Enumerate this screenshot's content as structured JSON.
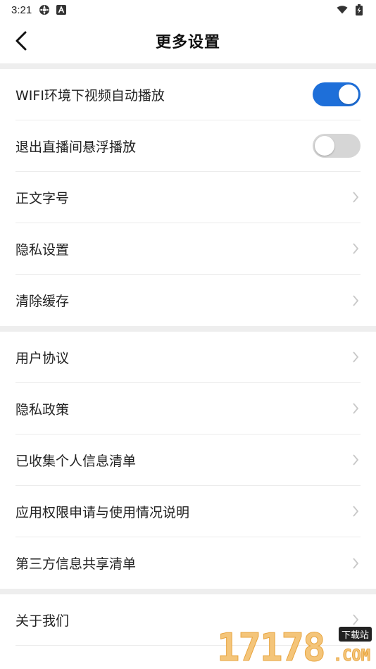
{
  "status_bar": {
    "time": "3:21",
    "icons": [
      "settings-gear-icon",
      "a-badge-icon",
      "wifi-icon",
      "battery-charging-icon"
    ]
  },
  "nav": {
    "title": "更多设置",
    "back_icon": "chevron-left-icon"
  },
  "groups": [
    {
      "items": [
        {
          "label": "WIFI环境下视频自动播放",
          "type": "toggle",
          "on": true
        },
        {
          "label": "退出直播间悬浮播放",
          "type": "toggle",
          "on": false
        },
        {
          "label": "正文字号",
          "type": "link"
        },
        {
          "label": "隐私设置",
          "type": "link"
        },
        {
          "label": "清除缓存",
          "type": "link"
        }
      ]
    },
    {
      "items": [
        {
          "label": "用户协议",
          "type": "link"
        },
        {
          "label": "隐私政策",
          "type": "link"
        },
        {
          "label": "已收集个人信息清单",
          "type": "link"
        },
        {
          "label": "应用权限申请与使用情况说明",
          "type": "link"
        },
        {
          "label": "第三方信息共享清单",
          "type": "link"
        }
      ]
    },
    {
      "items": [
        {
          "label": "关于我们",
          "type": "link"
        }
      ]
    }
  ],
  "watermark": {
    "digits": "17178",
    "tag": "下载站",
    "suffix": ".COM"
  },
  "colors": {
    "accent": "#1e6fd9",
    "divider_band": "#eeeeee",
    "chevron": "#c8c8c8"
  }
}
